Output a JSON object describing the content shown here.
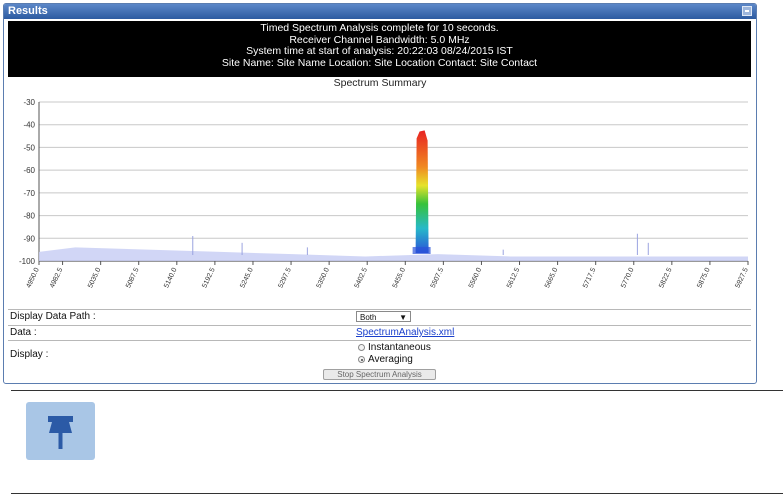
{
  "panel": {
    "title": "Results"
  },
  "info": {
    "lines": [
      "Timed Spectrum Analysis complete for 10 seconds.",
      "Receiver Channel Bandwidth: 5.0 MHz",
      "System time at start of analysis: 20:22:03 08/24/2015 IST",
      "Site Name: Site Name  Location: Site Location  Contact: Site Contact"
    ]
  },
  "chart_data": {
    "type": "area",
    "title": "Spectrum Summary",
    "ylim": [
      -100,
      -30
    ],
    "y_ticks": [
      "-30",
      "-40",
      "-50",
      "-60",
      "-70",
      "-80",
      "-90",
      "-100"
    ],
    "x_ticks": [
      "4950.0",
      "4982.5",
      "5035.0",
      "5087.5",
      "5140.0",
      "5192.5",
      "5245.0",
      "5297.5",
      "5350.0",
      "5402.5",
      "5455.0",
      "5507.5",
      "5560.0",
      "5612.5",
      "5665.0",
      "5717.5",
      "5770.0",
      "5822.5",
      "5875.0",
      "5927.5"
    ],
    "grid": true,
    "series": [
      {
        "values": [
          [
            4950.0,
            -96
          ],
          [
            5000.0,
            -94
          ],
          [
            5100.0,
            -95
          ],
          [
            5200.0,
            -96
          ],
          [
            5300.0,
            -97
          ],
          [
            5400.0,
            -98
          ],
          [
            5477.5,
            -43
          ],
          [
            5500.0,
            -97
          ],
          [
            5600.0,
            -98
          ],
          [
            5700.0,
            -98
          ],
          [
            5800.0,
            -98
          ],
          [
            5927.5,
            -98
          ]
        ]
      }
    ],
    "colors": {
      "floor": "#c9cff5",
      "peak_top": "#e82323",
      "peak_mid": "#37c23a",
      "peak_base": "#2b52d8"
    }
  },
  "controls": {
    "data_path": {
      "label": "Display Data Path :",
      "value": "Both"
    },
    "data": {
      "label": "Data :",
      "link": "SpectrumAnalysis.xml"
    },
    "display": {
      "label": "Display :",
      "options": [
        "Instantaneous",
        "Averaging"
      ],
      "selected": "Averaging"
    },
    "stop_button": "Stop Spectrum Analysis"
  },
  "note": {
    "icon": "pushpin-icon"
  }
}
